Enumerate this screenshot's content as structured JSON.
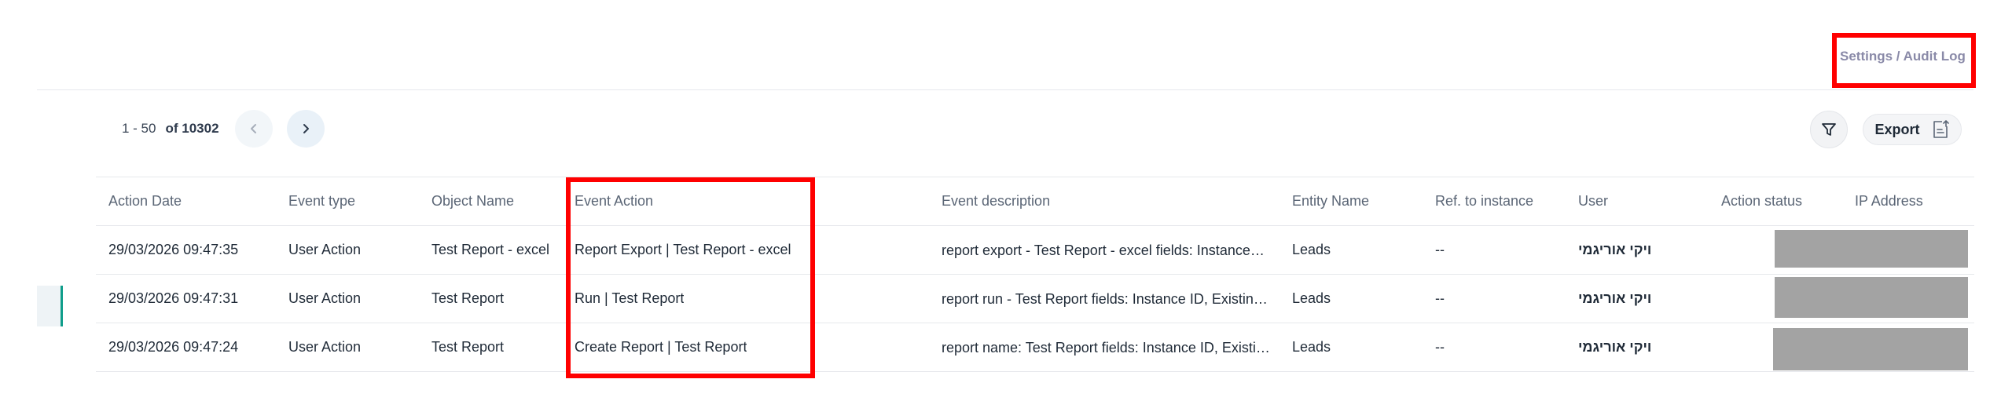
{
  "breadcrumb": "Settings / Audit Log",
  "pagination": {
    "range": "1 - 50",
    "total": "of 10302",
    "prev_icon": "chevron-left-icon",
    "next_icon": "chevron-right-icon"
  },
  "toolbar": {
    "filter_icon": "filter-icon",
    "export_label": "Export",
    "export_icon": "export-file-icon"
  },
  "table": {
    "columns": [
      "Action Date",
      "Event type",
      "Object Name",
      "Event Action",
      "Event description",
      "Entity Name",
      "Ref. to instance",
      "User",
      "Action status",
      "IP Address"
    ],
    "rows": [
      {
        "action_date": "29/03/2026 09:47:35",
        "event_type": "User Action",
        "object_name": "Test Report - excel",
        "event_action": "Report Export | Test Report - excel",
        "event_description": "report export - Test Report - excel fields: Instance…",
        "entity_name": "Leads",
        "ref_to_instance": "--",
        "user": "ויקי אוריגמי"
      },
      {
        "action_date": "29/03/2026 09:47:31",
        "event_type": "User Action",
        "object_name": "Test Report",
        "event_action": "Run | Test Report",
        "event_description": "report run - Test Report fields: Instance ID, Existin…",
        "entity_name": "Leads",
        "ref_to_instance": "--",
        "user": "ויקי אוריגמי"
      },
      {
        "action_date": "29/03/2026 09:47:24",
        "event_type": "User Action",
        "object_name": "Test Report",
        "event_action": "Create Report | Test Report",
        "event_description": "report name: Test Report fields: Instance ID, Existi…",
        "entity_name": "Leads",
        "ref_to_instance": "--",
        "user": "ויקי אוריגמי"
      }
    ]
  },
  "colors": {
    "accent": "#0f9d8a",
    "highlight_box": "#ff0000",
    "redacted": "#a3a3a3"
  }
}
